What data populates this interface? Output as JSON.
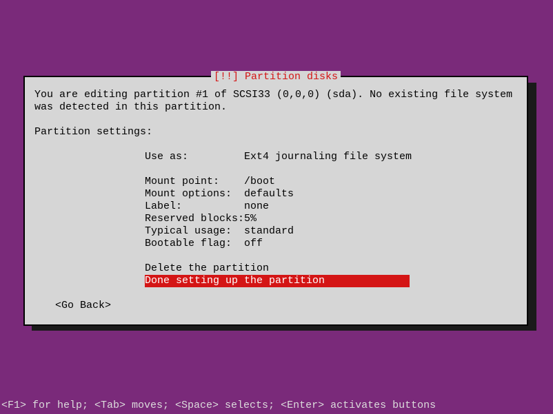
{
  "dialog": {
    "title_prefix": "[!!] ",
    "title": "Partition disks",
    "description": "You are editing partition #1 of SCSI33 (0,0,0) (sda). No existing file system was detected in this partition.",
    "subheading": "Partition settings:",
    "settings": [
      {
        "label": "Use as:",
        "value": "Ext4 journaling file system"
      },
      {
        "label": "",
        "value": ""
      },
      {
        "label": "Mount point:",
        "value": "/boot"
      },
      {
        "label": "Mount options:",
        "value": "defaults"
      },
      {
        "label": "Label:",
        "value": "none"
      },
      {
        "label": "Reserved blocks:",
        "value": "5%"
      },
      {
        "label": "Typical usage:",
        "value": "standard"
      },
      {
        "label": "Bootable flag:",
        "value": "off"
      }
    ],
    "actions": {
      "delete": "Delete the partition",
      "done": "Done setting up the partition"
    },
    "go_back": "<Go Back>"
  },
  "help_line": "<F1> for help; <Tab> moves; <Space> selects; <Enter> activates buttons"
}
